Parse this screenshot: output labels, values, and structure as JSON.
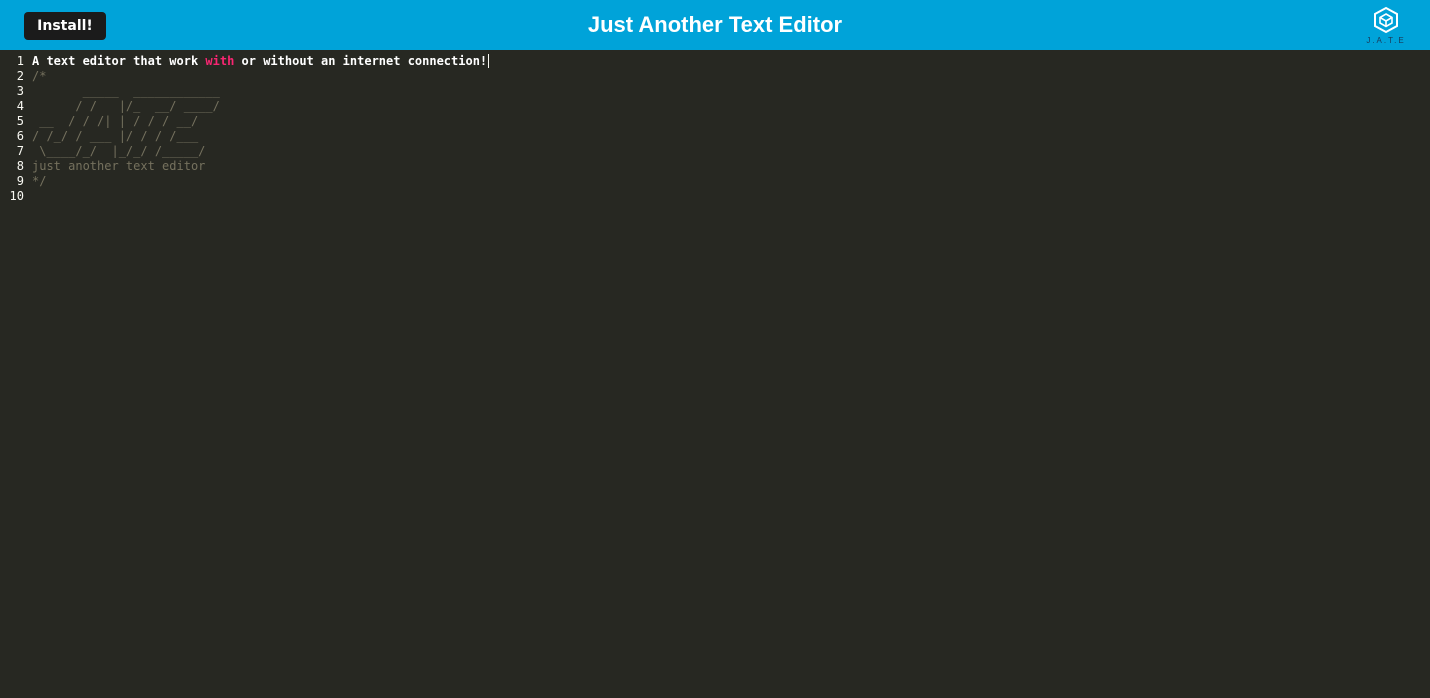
{
  "navbar": {
    "install_label": "Install!",
    "title": "Just Another Text Editor",
    "logo_text": "J.A.T.E",
    "background": "#00a3d9"
  },
  "editor": {
    "theme": {
      "background": "#272822",
      "text": "#f8f8f2",
      "keyword": "#f92672",
      "comment": "#75715e"
    },
    "line_1": {
      "before": "A text editor that work ",
      "keyword": "with",
      "after": " or without an internet connection!"
    },
    "lines": [
      {
        "num": "1"
      },
      {
        "num": "2",
        "text": "/*"
      },
      {
        "num": "3",
        "text": "       _____  ____________"
      },
      {
        "num": "4",
        "text": "      / /   |/_  __/ ____/"
      },
      {
        "num": "5",
        "text": " __  / / /| | / / / __/"
      },
      {
        "num": "6",
        "text": "/ /_/ / ___ |/ / / /___"
      },
      {
        "num": "7",
        "text": " \\____/_/  |_/_/ /_____/"
      },
      {
        "num": "8",
        "text": "just another text editor"
      },
      {
        "num": "9",
        "text": "*/"
      },
      {
        "num": "10",
        "text": ""
      }
    ]
  }
}
